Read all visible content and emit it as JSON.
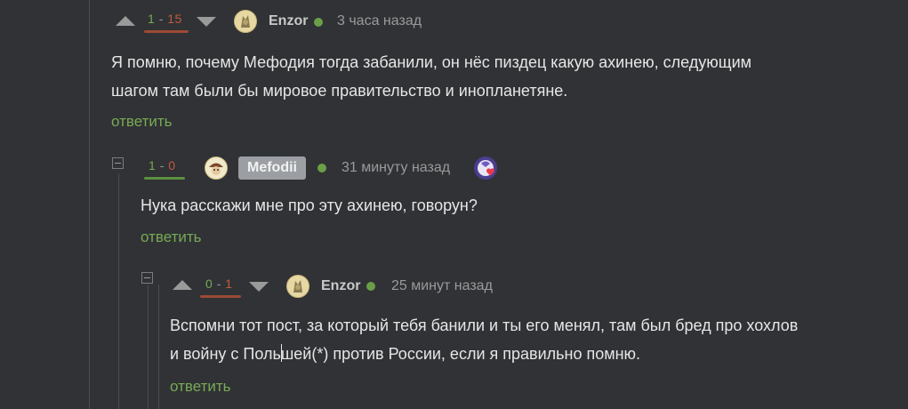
{
  "comments": [
    {
      "score_plus": "1",
      "score_sep": "-",
      "score_minus": "15",
      "author": "Enzor",
      "time": "3 часа назад",
      "text_line1": "Я помню, почему Мефодия тогда забанили, он нёс пиздец какую ахинею, следующим",
      "text_line2": "шагом там были бы мировое правительство и инопланетяне.",
      "reply_label": "ответить"
    },
    {
      "score_plus": "1",
      "score_sep": "-",
      "score_minus": "0",
      "author": "Mefodii",
      "time": "31 минуту назад",
      "text_line1": "Нука расскажи мне про эту ахинею, говорун?",
      "reply_label": "ответить"
    },
    {
      "score_plus": "0",
      "score_sep": "-",
      "score_minus": "1",
      "author": "Enzor",
      "time": "25 минут назад",
      "text_line1": "Вспомни тот пост, за который тебя банили и ты его менял, там был бред про хохлов",
      "text_line2_a": "и войну с Поль",
      "text_line2_b": "шей(*) против России, если я правильно помню.",
      "reply_label": "ответить"
    }
  ],
  "colors": {
    "background": "#303235",
    "plus": "#78a954",
    "minus": "#c1593d",
    "online": "#6b9f47",
    "reply": "#78a954"
  },
  "icons": {
    "vote_up": "triangle-up",
    "vote_down": "triangle-down",
    "collapse": "minus-square",
    "online": "green-dot",
    "award": "heart-badge"
  }
}
